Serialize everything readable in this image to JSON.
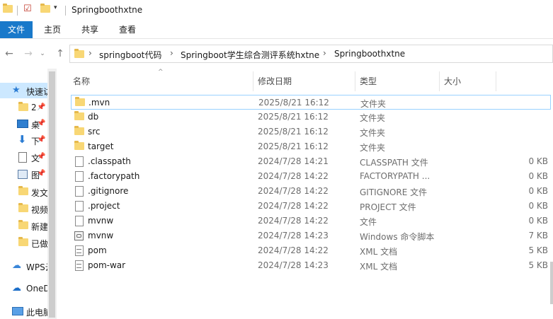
{
  "window": {
    "title": "Springboothxtne"
  },
  "ribbon": {
    "tabs": [
      "文件",
      "主页",
      "共享",
      "查看"
    ]
  },
  "address": {
    "crumbs": [
      "springboot代码",
      "Springboot学生综合测评系统hxtne",
      "Springboothxtne"
    ]
  },
  "columns": {
    "name": "名称",
    "date": "修改日期",
    "type": "类型",
    "size": "大小"
  },
  "nav": {
    "items": [
      {
        "label": "快速访",
        "icon": "star-icon"
      },
      {
        "label": "2",
        "icon": "folder-icon"
      },
      {
        "label": "桌",
        "icon": "desktop-icon"
      },
      {
        "label": "下",
        "icon": "download-icon"
      },
      {
        "label": "文",
        "icon": "document-icon"
      },
      {
        "label": "图",
        "icon": "picture-icon"
      },
      {
        "label": "发文",
        "icon": "folder-icon"
      },
      {
        "label": "视频",
        "icon": "folder-icon"
      },
      {
        "label": "新建",
        "icon": "folder-icon"
      },
      {
        "label": "已做",
        "icon": "folder-icon"
      },
      {
        "label": "WPS云",
        "icon": "cloud-icon"
      },
      {
        "label": "OneD",
        "icon": "onedrive-icon"
      },
      {
        "label": "此电脑",
        "icon": "computer-icon"
      }
    ]
  },
  "files": [
    {
      "name": ".mvn",
      "date": "2025/8/21 16:12",
      "type": "文件夹",
      "size": "",
      "icon": "folder-icon"
    },
    {
      "name": "db",
      "date": "2025/8/21 16:12",
      "type": "文件夹",
      "size": "",
      "icon": "folder-icon"
    },
    {
      "name": "src",
      "date": "2025/8/21 16:12",
      "type": "文件夹",
      "size": "",
      "icon": "folder-icon"
    },
    {
      "name": "target",
      "date": "2025/8/21 16:12",
      "type": "文件夹",
      "size": "",
      "icon": "folder-icon"
    },
    {
      "name": ".classpath",
      "date": "2024/7/28 14:21",
      "type": "CLASSPATH 文件",
      "size": "0 KB",
      "icon": "file-icon"
    },
    {
      "name": ".factorypath",
      "date": "2024/7/28 14:22",
      "type": "FACTORYPATH ...",
      "size": "0 KB",
      "icon": "file-icon"
    },
    {
      "name": ".gitignore",
      "date": "2024/7/28 14:22",
      "type": "GITIGNORE 文件",
      "size": "0 KB",
      "icon": "file-icon"
    },
    {
      "name": ".project",
      "date": "2024/7/28 14:22",
      "type": "PROJECT 文件",
      "size": "0 KB",
      "icon": "file-icon"
    },
    {
      "name": "mvnw",
      "date": "2024/7/28 14:22",
      "type": "文件",
      "size": "0 KB",
      "icon": "file-icon"
    },
    {
      "name": "mvnw",
      "date": "2024/7/28 14:23",
      "type": "Windows 命令脚本",
      "size": "7 KB",
      "icon": "cmd-script-icon"
    },
    {
      "name": "pom",
      "date": "2024/7/28 14:22",
      "type": "XML 文档",
      "size": "5 KB",
      "icon": "xml-document-icon"
    },
    {
      "name": "pom-war",
      "date": "2024/7/28 14:23",
      "type": "XML 文档",
      "size": "5 KB",
      "icon": "xml-document-icon"
    }
  ]
}
